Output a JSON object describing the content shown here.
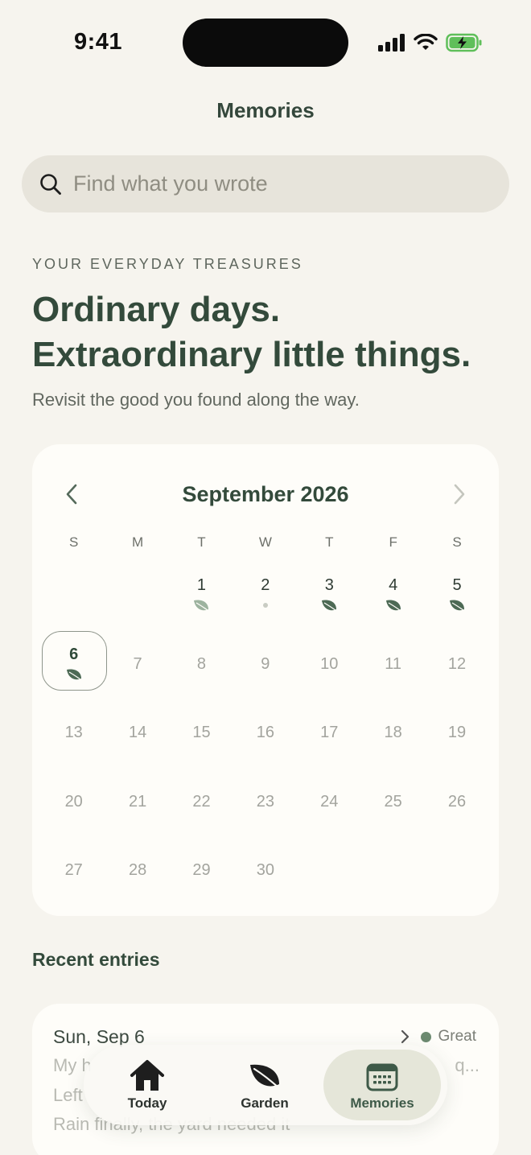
{
  "status_bar": {
    "time": "9:41"
  },
  "header": {
    "title": "Memories"
  },
  "search": {
    "placeholder": "Find what you wrote",
    "value": ""
  },
  "hero": {
    "eyebrow": "YOUR EVERYDAY TREASURES",
    "headline_line1": "Ordinary days.",
    "headline_line2": "Extraordinary little things.",
    "subhead": "Revisit the good you found along the way."
  },
  "calendar": {
    "month_label": "September 2026",
    "weekdays": [
      "S",
      "M",
      "T",
      "W",
      "T",
      "F",
      "S"
    ],
    "leading_blank_days": 2,
    "today": "6",
    "days": [
      {
        "label": "1",
        "marker": "leaf-light"
      },
      {
        "label": "2",
        "marker": "dot"
      },
      {
        "label": "3",
        "marker": "leaf"
      },
      {
        "label": "4",
        "marker": "leaf"
      },
      {
        "label": "5",
        "marker": "leaf"
      },
      {
        "label": "6",
        "marker": "leaf"
      },
      {
        "label": "7",
        "marker": ""
      },
      {
        "label": "8",
        "marker": ""
      },
      {
        "label": "9",
        "marker": ""
      },
      {
        "label": "10",
        "marker": ""
      },
      {
        "label": "11",
        "marker": ""
      },
      {
        "label": "12",
        "marker": ""
      },
      {
        "label": "13",
        "marker": ""
      },
      {
        "label": "14",
        "marker": ""
      },
      {
        "label": "15",
        "marker": ""
      },
      {
        "label": "16",
        "marker": ""
      },
      {
        "label": "17",
        "marker": ""
      },
      {
        "label": "18",
        "marker": ""
      },
      {
        "label": "19",
        "marker": ""
      },
      {
        "label": "20",
        "marker": ""
      },
      {
        "label": "21",
        "marker": ""
      },
      {
        "label": "22",
        "marker": ""
      },
      {
        "label": "23",
        "marker": ""
      },
      {
        "label": "24",
        "marker": ""
      },
      {
        "label": "25",
        "marker": ""
      },
      {
        "label": "26",
        "marker": ""
      },
      {
        "label": "27",
        "marker": ""
      },
      {
        "label": "28",
        "marker": ""
      },
      {
        "label": "29",
        "marker": ""
      },
      {
        "label": "30",
        "marker": ""
      }
    ]
  },
  "recent": {
    "title": "Recent entries",
    "entry": {
      "date": "Sun, Sep 6",
      "mood": "Great",
      "line1": "My h",
      "line1_end": "q...",
      "line2": "Left",
      "line3": "Rain finally, the yard needed it"
    }
  },
  "tabs": [
    {
      "label": "Today",
      "icon": "house-icon"
    },
    {
      "label": "Garden",
      "icon": "leaf-icon"
    },
    {
      "label": "Memories",
      "icon": "calendar-icon",
      "active": true
    }
  ],
  "colors": {
    "background": "#f6f4ee",
    "card": "#fefdf9",
    "primary": "#334a3b",
    "leaf": "#4d6a55",
    "leaf_light": "#9db39f",
    "mood_great": "#6c8a70"
  }
}
